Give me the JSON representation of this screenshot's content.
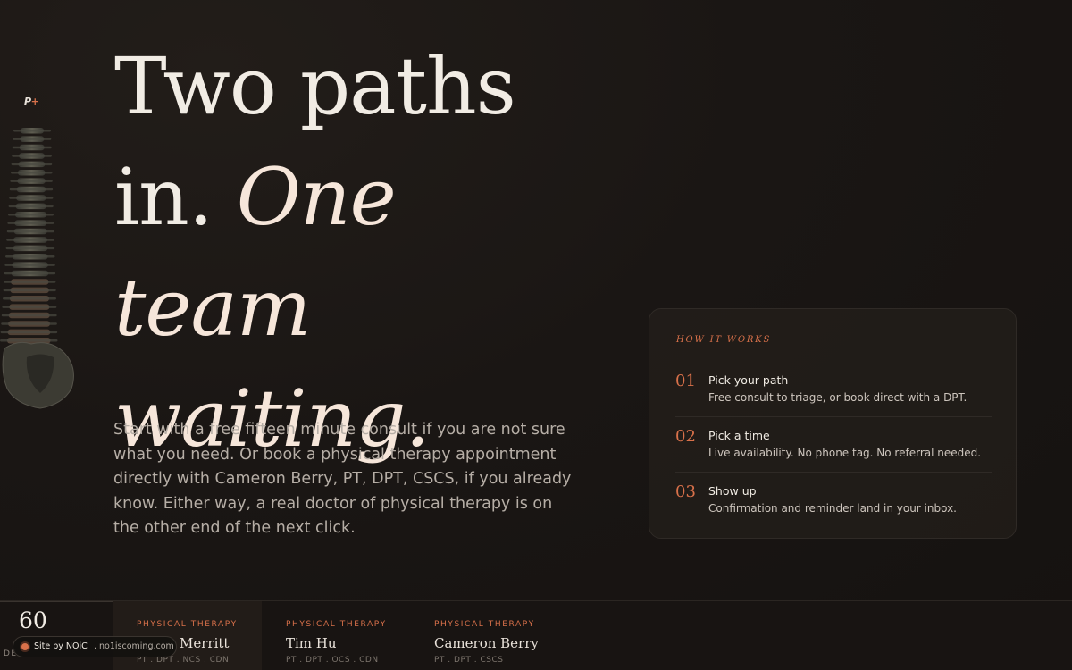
{
  "brand": {
    "logo_text": "P",
    "logo_plus": "+"
  },
  "hero": {
    "line1": "Two paths",
    "line2_plain": "in.",
    "line2_italic": "One team",
    "line3_italic": "waiting."
  },
  "intro": "Start with a free fifteen minute consult if you are not sure what you need. Or book a physical therapy appointment directly with Cameron Berry, PT, DPT, CSCS, if you already know. Either way, a real doctor of physical therapy is on the other end of the next click.",
  "how_it_works": {
    "eyebrow": "HOW IT WORKS",
    "steps": [
      {
        "number": "01",
        "title": "Pick your path",
        "description": "Free consult to triage, or book direct with a DPT."
      },
      {
        "number": "02",
        "title": "Pick a time",
        "description": "Live availability. No phone tag. No referral needed."
      },
      {
        "number": "03",
        "title": "Show up",
        "description": "Confirmation and reminder land in your inbox."
      }
    ]
  },
  "footer": {
    "count": "60",
    "count_label": "DE",
    "members": [
      {
        "category": "PHYSICAL THERAPY",
        "name": "Merritt",
        "credentials": "PT . DPT . NCS . CDN"
      },
      {
        "category": "PHYSICAL THERAPY",
        "name": "Tim Hu",
        "credentials": "PT . DPT . OCS . CDN"
      },
      {
        "category": "PHYSICAL THERAPY",
        "name": "Cameron Berry",
        "credentials": "PT . DPT . CSCS"
      }
    ]
  },
  "credit": {
    "site": "Site by NOiC",
    "url": ". no1iscoming.com"
  },
  "colors": {
    "accent": "#d9714a",
    "background": "#1a1614",
    "text": "#f1ece4",
    "muted": "#b6aea6"
  }
}
